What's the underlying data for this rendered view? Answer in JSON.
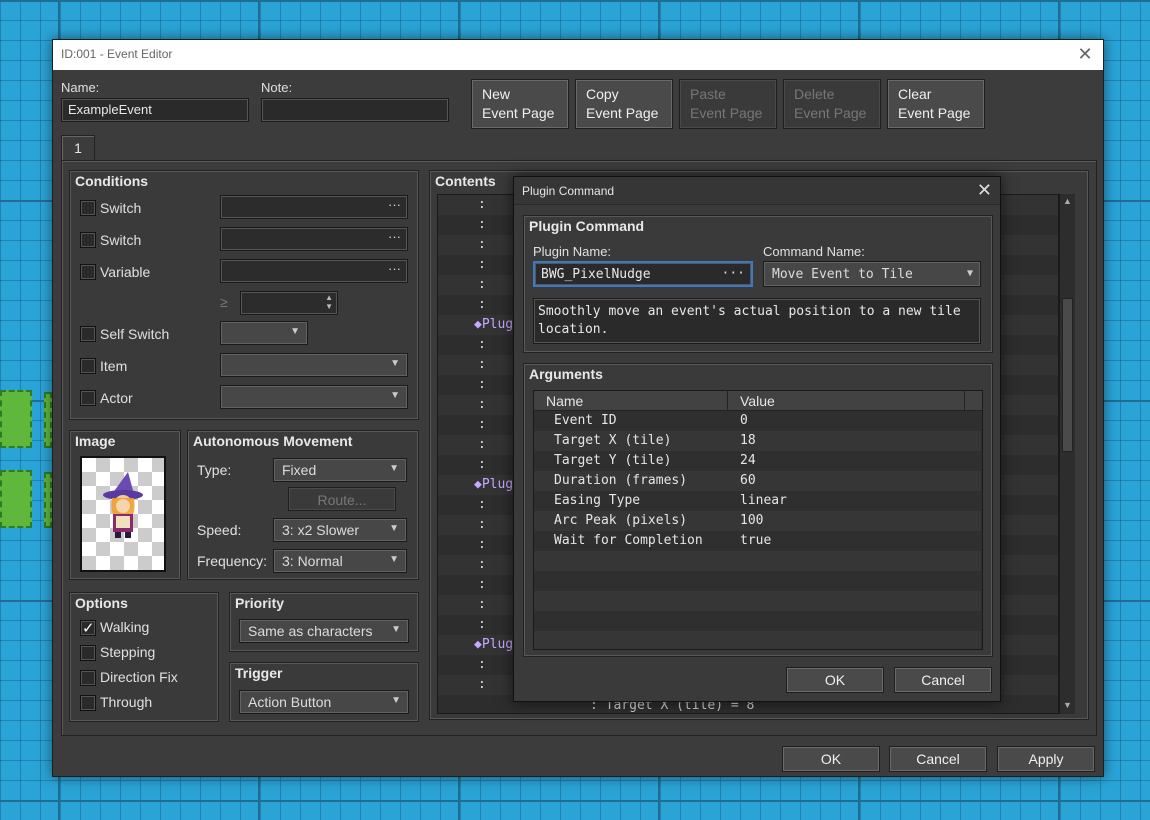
{
  "editor": {
    "title": "ID:001 - Event Editor",
    "name_label": "Name:",
    "name_value": "ExampleEvent",
    "note_label": "Note:",
    "note_value": "",
    "buttons": {
      "new_l1": "New",
      "new_l2": "Event Page",
      "copy_l1": "Copy",
      "copy_l2": "Event Page",
      "paste_l1": "Paste",
      "paste_l2": "Event Page",
      "delete_l1": "Delete",
      "delete_l2": "Event Page",
      "clear_l1": "Clear",
      "clear_l2": "Event Page"
    },
    "tab_label": "1",
    "conditions": {
      "title": "Conditions",
      "switch1": "Switch",
      "switch2": "Switch",
      "variable": "Variable",
      "gte": "≥",
      "self_switch": "Self Switch",
      "item": "Item",
      "actor": "Actor"
    },
    "image_title": "Image",
    "movement": {
      "title": "Autonomous Movement",
      "type_label": "Type:",
      "type_value": "Fixed",
      "route_button": "Route...",
      "speed_label": "Speed:",
      "speed_value": "3: x2 Slower",
      "freq_label": "Frequency:",
      "freq_value": "3: Normal"
    },
    "options": {
      "title": "Options",
      "walking": "Walking",
      "stepping": "Stepping",
      "direction_fix": "Direction Fix",
      "through": "Through"
    },
    "priority": {
      "title": "Priority",
      "value": "Same as characters"
    },
    "trigger": {
      "title": "Trigger",
      "value": "Action Button"
    },
    "contents_title": "Contents",
    "contents_rows": [
      ":",
      ":",
      ":",
      ":",
      ":",
      ":",
      "◆Plug",
      ":",
      ":",
      ":",
      ":",
      ":",
      ":",
      ":",
      "◆Plug",
      ":",
      ":",
      ":",
      ":",
      ":",
      ":",
      ":",
      "◆Plug",
      ":",
      ":"
    ],
    "contents_last_text": ": Target X (tile) = 8",
    "ok": "OK",
    "cancel": "Cancel",
    "apply": "Apply"
  },
  "plugin_dialog": {
    "title": "Plugin Command",
    "group_title": "Plugin Command",
    "plugin_name_label": "Plugin Name:",
    "plugin_name_value": "BWG_PixelNudge",
    "command_name_label": "Command Name:",
    "command_name_value": "Move Event to Tile",
    "description": "Smoothly move an event's actual position to a new tile location.",
    "arguments_title": "Arguments",
    "col_name": "Name",
    "col_value": "Value",
    "arguments": [
      {
        "name": "Event ID",
        "value": "0"
      },
      {
        "name": "Target X (tile)",
        "value": "18"
      },
      {
        "name": "Target Y (tile)",
        "value": "24"
      },
      {
        "name": "Duration (frames)",
        "value": "60"
      },
      {
        "name": "Easing Type",
        "value": "linear"
      },
      {
        "name": "Arc Peak (pixels)",
        "value": "100"
      },
      {
        "name": "Wait for Completion",
        "value": "true"
      }
    ],
    "ok": "OK",
    "cancel": "Cancel"
  }
}
